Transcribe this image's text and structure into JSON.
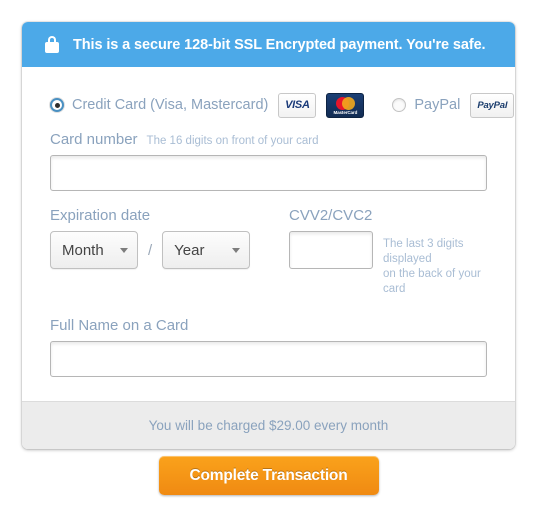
{
  "banner": {
    "icon": "lock-icon",
    "text": "This is a secure 128-bit SSL Encrypted payment. You're safe.",
    "background_color": "#4ca9e8"
  },
  "payment_methods": {
    "credit_card": {
      "label": "Credit Card (Visa, Mastercard)",
      "selected": true,
      "logos": [
        {
          "name": "visa-logo",
          "text": "VISA"
        },
        {
          "name": "mastercard-logo",
          "text": "MasterCard"
        }
      ]
    },
    "paypal": {
      "label": "PayPal",
      "selected": false,
      "logo": {
        "name": "paypal-logo",
        "text": "PayPal"
      }
    }
  },
  "fields": {
    "card_number": {
      "label": "Card number",
      "hint": "The 16 digits on front of your card",
      "value": "",
      "placeholder": ""
    },
    "expiration": {
      "label": "Expiration date",
      "month": "Month",
      "year": "Year",
      "separator": "/"
    },
    "cvv": {
      "label": "CVV2/CVC2",
      "value": "",
      "placeholder": "",
      "hint_line1": "The last 3 digits displayed",
      "hint_line2": "on the back of your card"
    },
    "full_name": {
      "label": "Full Name on a Card",
      "value": "",
      "placeholder": ""
    }
  },
  "footer": {
    "charge_notice": "You will be charged $29.00 every month"
  },
  "cta": {
    "label": "Complete Transaction",
    "color": "#f9a01b"
  }
}
